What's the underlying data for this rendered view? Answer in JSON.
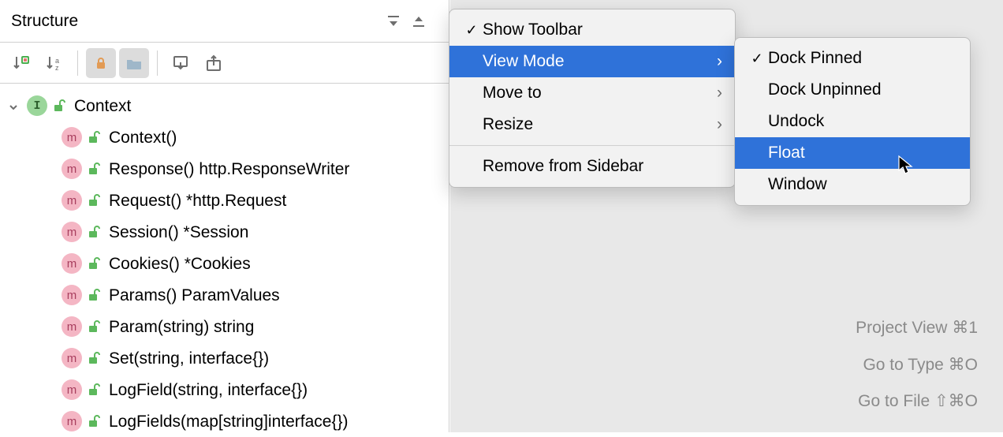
{
  "panel": {
    "title": "Structure"
  },
  "tree": {
    "root": {
      "label": "Context"
    },
    "members": [
      {
        "label": "Context()"
      },
      {
        "label": "Response() http.ResponseWriter"
      },
      {
        "label": "Request() *http.Request"
      },
      {
        "label": "Session() *Session"
      },
      {
        "label": "Cookies() *Cookies"
      },
      {
        "label": "Params() ParamValues"
      },
      {
        "label": "Param(string) string"
      },
      {
        "label": "Set(string, interface{})"
      },
      {
        "label": "LogField(string, interface{})"
      },
      {
        "label": "LogFields(map[string]interface{})"
      }
    ]
  },
  "menu1": {
    "show_toolbar": "Show Toolbar",
    "view_mode": "View Mode",
    "move_to": "Move to",
    "resize": "Resize",
    "remove": "Remove from Sidebar"
  },
  "menu2": {
    "dock_pinned": "Dock Pinned",
    "dock_unpinned": "Dock Unpinned",
    "undock": "Undock",
    "float": "Float",
    "window": "Window"
  },
  "hints": {
    "project_view": {
      "label": "Project View",
      "shortcut": "⌘1"
    },
    "go_to_type": {
      "label": "Go to Type",
      "shortcut": "⌘O"
    },
    "go_to_file": {
      "label": "Go to File",
      "shortcut": "⇧⌘O"
    }
  }
}
